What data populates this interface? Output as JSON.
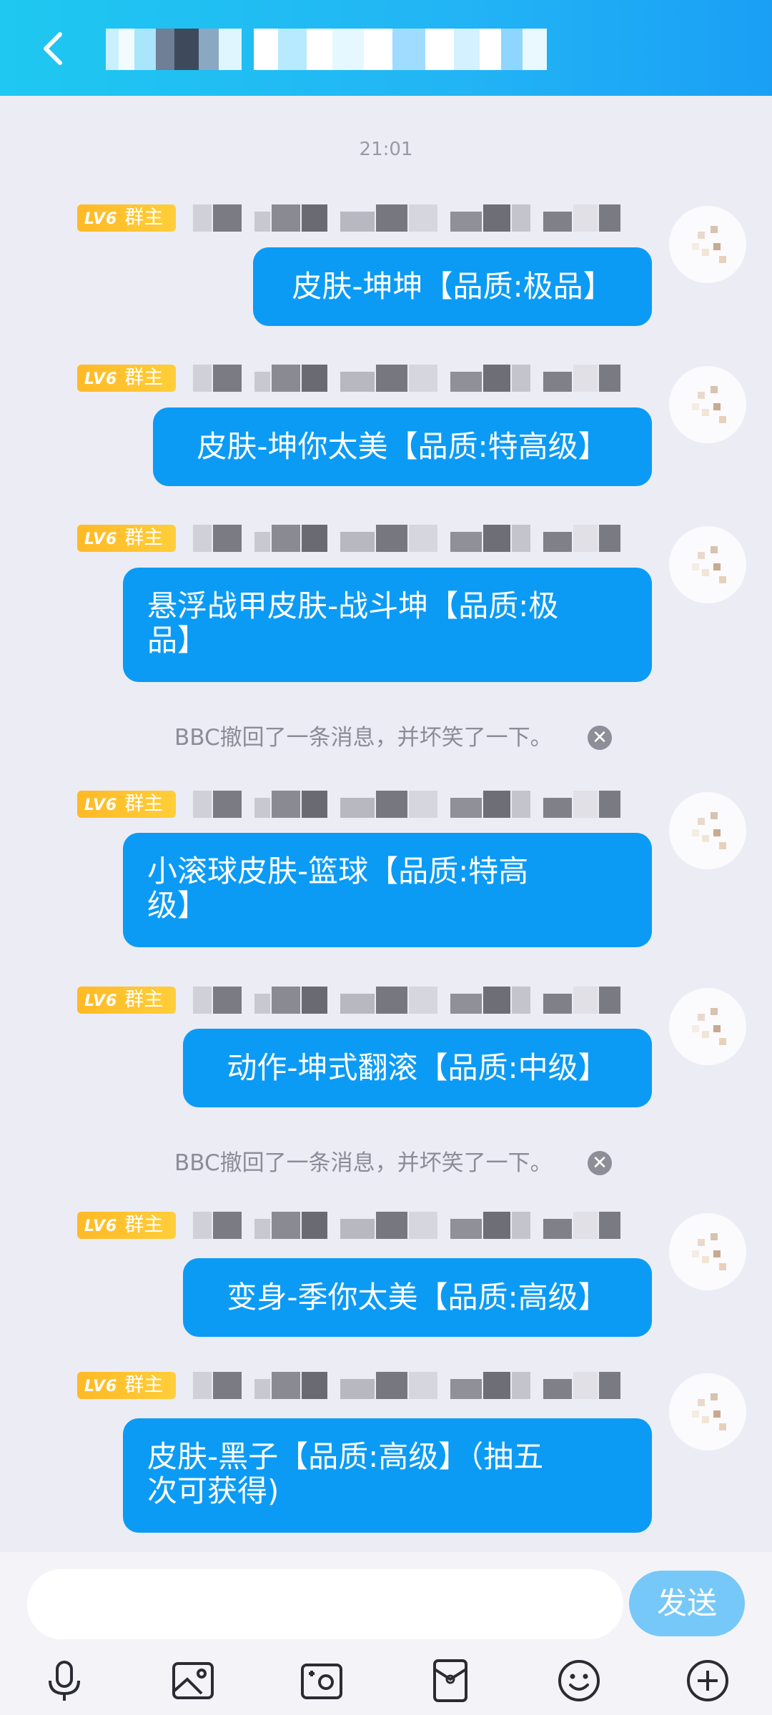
{
  "header": {
    "back_icon": "chevron-left-icon",
    "title": "",
    "background": "#1eb6f4"
  },
  "chat": {
    "timestamp": "21:01",
    "messages": [
      {
        "badge_level": "LV6",
        "badge_role": "群主",
        "text": "皮肤-坤坤【品质:极品】"
      },
      {
        "badge_level": "LV6",
        "badge_role": "群主",
        "text": "皮肤-坤你太美【品质:特高级】"
      },
      {
        "badge_level": "LV6",
        "badge_role": "群主",
        "text": "悬浮战甲皮肤-战斗坤【品质:极\n品】"
      },
      {
        "badge_level": "LV6",
        "badge_role": "群主",
        "text": "小滚球皮肤-篮球【品质:特高\n级】"
      },
      {
        "badge_level": "LV6",
        "badge_role": "群主",
        "text": "动作-坤式翻滚【品质:中级】"
      },
      {
        "badge_level": "LV6",
        "badge_role": "群主",
        "text": "变身-季你太美【品质:高级】"
      },
      {
        "badge_level": "LV6",
        "badge_role": "群主",
        "text": "皮肤-黑子【品质:高级】（抽五\n次可获得)"
      }
    ],
    "system_notices": [
      {
        "text": "BBC撤回了一条消息，并坏笑了一下。"
      },
      {
        "text": "BBC撤回了一条消息，并坏笑了一下。"
      }
    ],
    "bubble_color": "#0b9bf5",
    "badge_color": "#ffc02e"
  },
  "input_bar": {
    "placeholder": "",
    "send_label": "发送",
    "send_color": "#76c8f8",
    "tools": [
      "microphone-icon",
      "image-icon",
      "camera-icon",
      "red-packet-icon",
      "emoji-icon",
      "plus-icon"
    ]
  }
}
